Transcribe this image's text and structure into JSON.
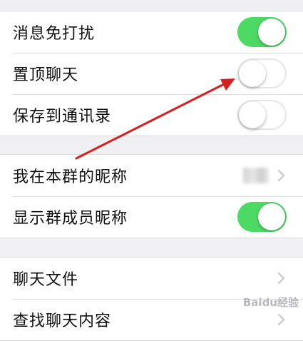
{
  "group1": {
    "rows": [
      {
        "label": "消息免打扰",
        "toggle": "on"
      },
      {
        "label": "置顶聊天",
        "toggle": "off"
      },
      {
        "label": "保存到通讯录",
        "toggle": "off"
      }
    ]
  },
  "group2": {
    "rows": [
      {
        "label": "我在本群的昵称"
      },
      {
        "label": "显示群成员昵称",
        "toggle": "on"
      }
    ]
  },
  "group3": {
    "rows": [
      {
        "label": "聊天文件"
      },
      {
        "label": "查找聊天内容"
      }
    ]
  },
  "watermark": "Baidu经验",
  "colors": {
    "toggle_on": "#4cd964",
    "background": "#efeff4",
    "arrow": "#d6201f"
  }
}
